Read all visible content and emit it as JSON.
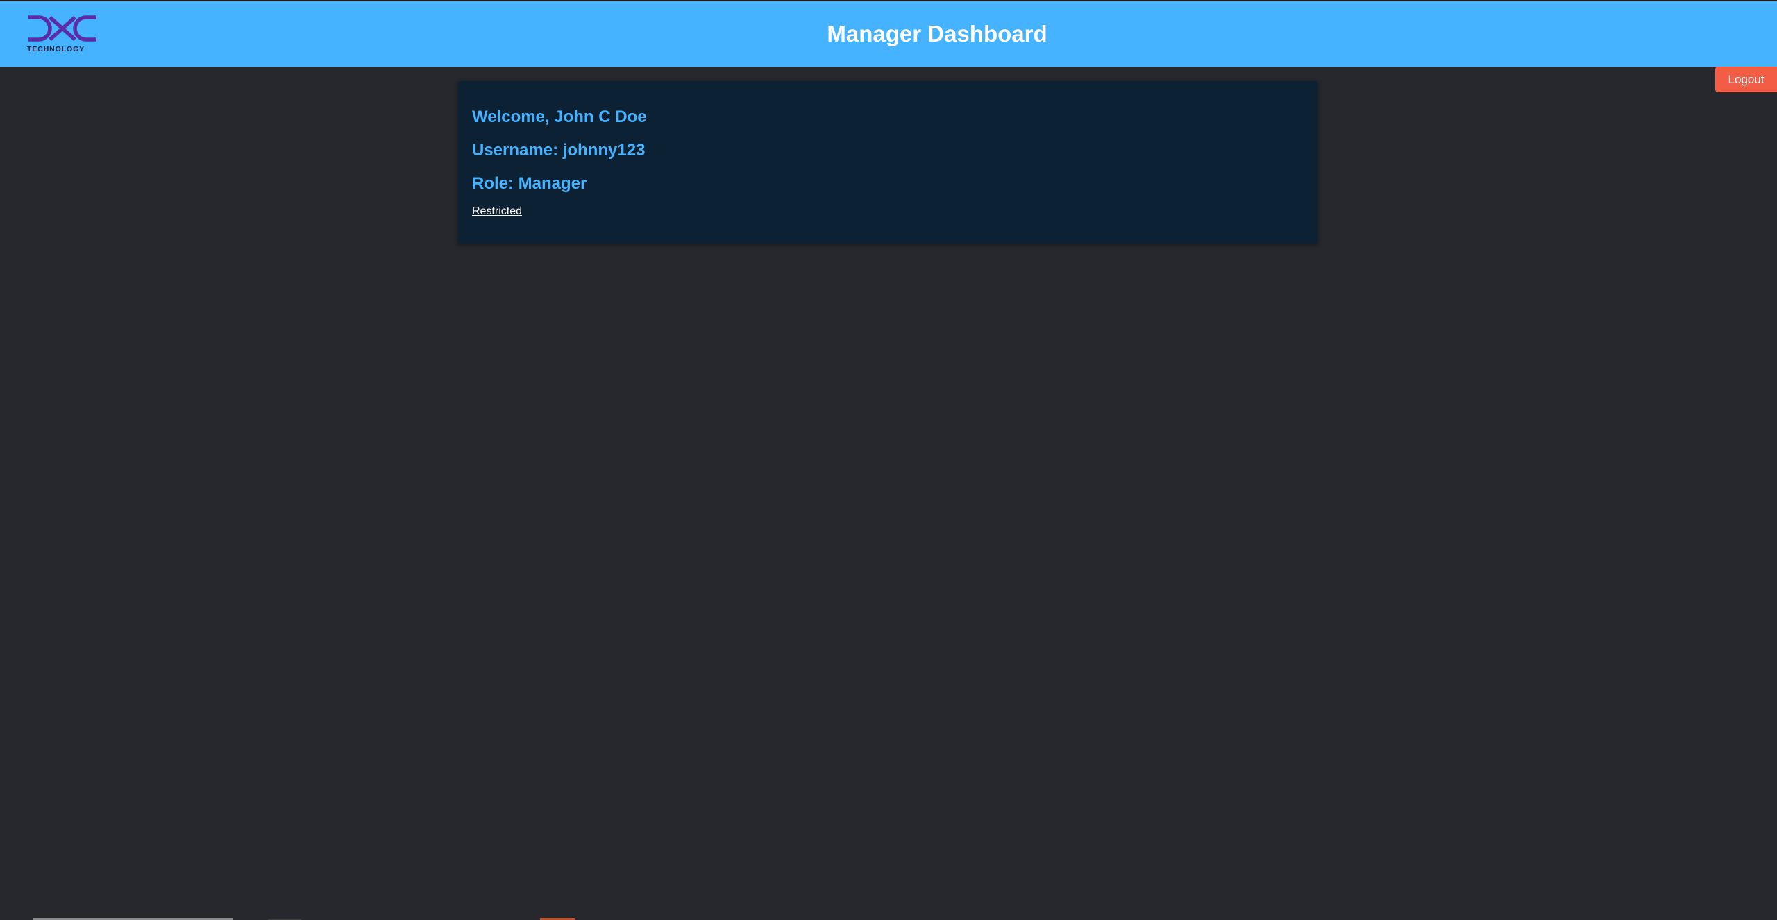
{
  "header": {
    "logo_text": "TECHNOLOGY",
    "title": "Manager Dashboard",
    "background_color": "#45b3ff",
    "logo_color": "#5c2ca8"
  },
  "logout": {
    "label": "Logout",
    "color": "#f45d45"
  },
  "profile": {
    "welcome": "Welcome, John C Doe",
    "username": "Username: johnny123",
    "role": "Role: Manager",
    "restricted_link": "Restricted",
    "text_color": "#45b3ff",
    "card_color": "#0c2234"
  },
  "page": {
    "background_color": "#26282d"
  }
}
